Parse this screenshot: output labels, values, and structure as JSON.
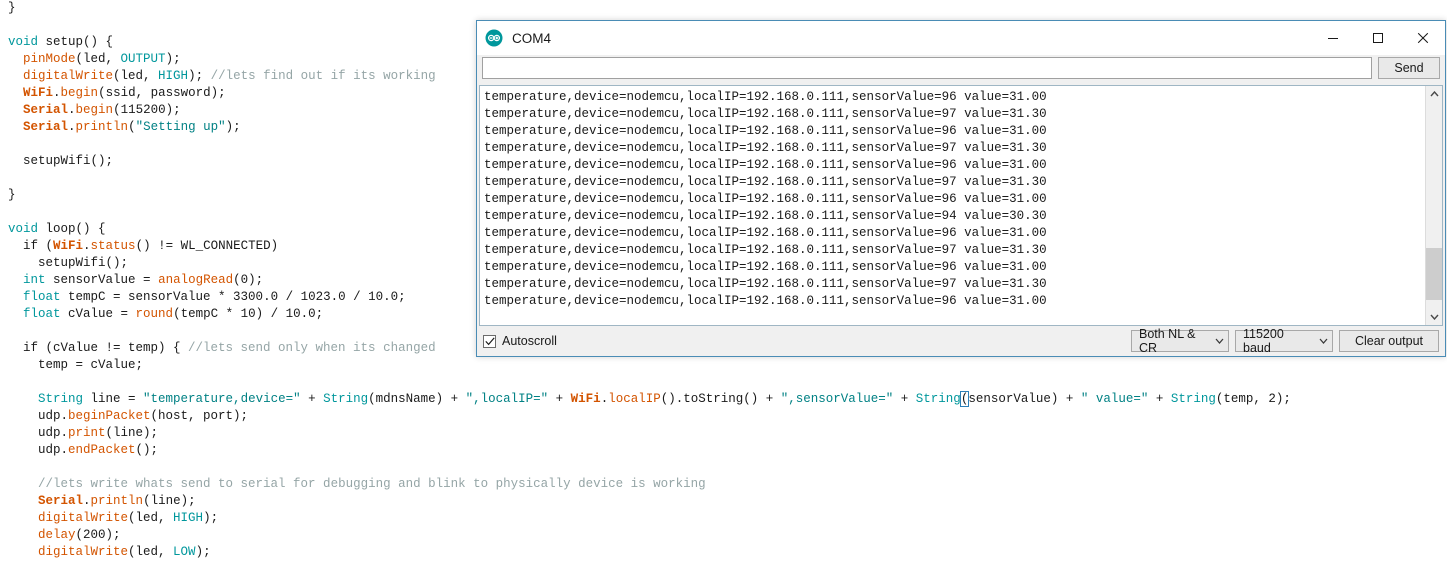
{
  "editor": {
    "lines": [
      [
        {
          "t": "}",
          "c": "pln"
        }
      ],
      [],
      [
        {
          "t": "void ",
          "c": "kw"
        },
        {
          "t": "setup",
          "c": "pln"
        },
        {
          "t": "() {",
          "c": "pln"
        }
      ],
      [
        {
          "t": "  ",
          "c": "pln"
        },
        {
          "t": "pinMode",
          "c": "fn"
        },
        {
          "t": "(led, ",
          "c": "pln"
        },
        {
          "t": "OUTPUT",
          "c": "cst"
        },
        {
          "t": ");",
          "c": "pln"
        }
      ],
      [
        {
          "t": "  ",
          "c": "pln"
        },
        {
          "t": "digitalWrite",
          "c": "fn"
        },
        {
          "t": "(led, ",
          "c": "pln"
        },
        {
          "t": "HIGH",
          "c": "cst"
        },
        {
          "t": "); ",
          "c": "pln"
        },
        {
          "t": "//lets find out if its working",
          "c": "cmt"
        }
      ],
      [
        {
          "t": "  ",
          "c": "pln"
        },
        {
          "t": "WiFi",
          "c": "fnb"
        },
        {
          "t": ".",
          "c": "pln"
        },
        {
          "t": "begin",
          "c": "fn"
        },
        {
          "t": "(ssid, password);",
          "c": "pln"
        }
      ],
      [
        {
          "t": "  ",
          "c": "pln"
        },
        {
          "t": "Serial",
          "c": "fnb"
        },
        {
          "t": ".",
          "c": "pln"
        },
        {
          "t": "begin",
          "c": "fn"
        },
        {
          "t": "(115200);",
          "c": "pln"
        }
      ],
      [
        {
          "t": "  ",
          "c": "pln"
        },
        {
          "t": "Serial",
          "c": "fnb"
        },
        {
          "t": ".",
          "c": "pln"
        },
        {
          "t": "println",
          "c": "fn"
        },
        {
          "t": "(",
          "c": "pln"
        },
        {
          "t": "\"Setting up\"",
          "c": "str"
        },
        {
          "t": ");",
          "c": "pln"
        }
      ],
      [],
      [
        {
          "t": "  setupWifi();",
          "c": "pln"
        }
      ],
      [],
      [
        {
          "t": "}",
          "c": "pln"
        }
      ],
      [],
      [
        {
          "t": "void ",
          "c": "kw"
        },
        {
          "t": "loop",
          "c": "pln"
        },
        {
          "t": "() {",
          "c": "pln"
        }
      ],
      [
        {
          "t": "  if (",
          "c": "pln"
        },
        {
          "t": "WiFi",
          "c": "fnb"
        },
        {
          "t": ".",
          "c": "pln"
        },
        {
          "t": "status",
          "c": "fn"
        },
        {
          "t": "() != WL_CONNECTED)",
          "c": "pln"
        }
      ],
      [
        {
          "t": "    setupWifi();",
          "c": "pln"
        }
      ],
      [
        {
          "t": "  ",
          "c": "pln"
        },
        {
          "t": "int ",
          "c": "kw"
        },
        {
          "t": "sensorValue = ",
          "c": "pln"
        },
        {
          "t": "analogRead",
          "c": "fn"
        },
        {
          "t": "(0);",
          "c": "pln"
        }
      ],
      [
        {
          "t": "  ",
          "c": "pln"
        },
        {
          "t": "float ",
          "c": "kw"
        },
        {
          "t": "tempC = sensorValue * 3300.0 / 1023.0 / 10.0;",
          "c": "pln"
        }
      ],
      [
        {
          "t": "  ",
          "c": "pln"
        },
        {
          "t": "float ",
          "c": "kw"
        },
        {
          "t": "cValue = ",
          "c": "pln"
        },
        {
          "t": "round",
          "c": "fn"
        },
        {
          "t": "(tempC * 10) / 10.0;",
          "c": "pln"
        }
      ],
      [],
      [
        {
          "t": "  if (cValue != temp) { ",
          "c": "pln"
        },
        {
          "t": "//lets send only when its changed",
          "c": "cmt"
        }
      ],
      [
        {
          "t": "    temp = cValue;",
          "c": "pln"
        }
      ],
      [],
      [
        {
          "t": "    ",
          "c": "pln"
        },
        {
          "t": "String ",
          "c": "cst"
        },
        {
          "t": "line = ",
          "c": "pln"
        },
        {
          "t": "\"temperature,device=\"",
          "c": "str"
        },
        {
          "t": " + ",
          "c": "pln"
        },
        {
          "t": "String",
          "c": "cst"
        },
        {
          "t": "(mdnsName) + ",
          "c": "pln"
        },
        {
          "t": "\",localIP=\"",
          "c": "str"
        },
        {
          "t": " + ",
          "c": "pln"
        },
        {
          "t": "WiFi",
          "c": "fnb"
        },
        {
          "t": ".",
          "c": "pln"
        },
        {
          "t": "localIP",
          "c": "fn"
        },
        {
          "t": "().toString() + ",
          "c": "pln"
        },
        {
          "t": "\",sensorValue=\"",
          "c": "str"
        },
        {
          "t": " + ",
          "c": "pln"
        },
        {
          "t": "String",
          "c": "cst"
        },
        {
          "t": "(",
          "c": "brkt"
        },
        {
          "t": "sensorValue) + ",
          "c": "pln"
        },
        {
          "t": "\" value=\"",
          "c": "str"
        },
        {
          "t": " + ",
          "c": "pln"
        },
        {
          "t": "String",
          "c": "cst"
        },
        {
          "t": "(temp, 2);",
          "c": "pln"
        }
      ],
      [
        {
          "t": "    udp.",
          "c": "pln"
        },
        {
          "t": "beginPacket",
          "c": "fn"
        },
        {
          "t": "(host, port);",
          "c": "pln"
        }
      ],
      [
        {
          "t": "    udp.",
          "c": "pln"
        },
        {
          "t": "print",
          "c": "fn"
        },
        {
          "t": "(line);",
          "c": "pln"
        }
      ],
      [
        {
          "t": "    udp.",
          "c": "pln"
        },
        {
          "t": "endPacket",
          "c": "fn"
        },
        {
          "t": "();",
          "c": "pln"
        }
      ],
      [],
      [
        {
          "t": "    ",
          "c": "pln"
        },
        {
          "t": "//lets write whats send to serial for debugging and blink to physically device is working",
          "c": "cmt"
        }
      ],
      [
        {
          "t": "    ",
          "c": "pln"
        },
        {
          "t": "Serial",
          "c": "fnb"
        },
        {
          "t": ".",
          "c": "pln"
        },
        {
          "t": "println",
          "c": "fn"
        },
        {
          "t": "(line);",
          "c": "pln"
        }
      ],
      [
        {
          "t": "    ",
          "c": "pln"
        },
        {
          "t": "digitalWrite",
          "c": "fn"
        },
        {
          "t": "(led, ",
          "c": "pln"
        },
        {
          "t": "HIGH",
          "c": "cst"
        },
        {
          "t": ");",
          "c": "pln"
        }
      ],
      [
        {
          "t": "    ",
          "c": "pln"
        },
        {
          "t": "delay",
          "c": "fn"
        },
        {
          "t": "(200);",
          "c": "pln"
        }
      ],
      [
        {
          "t": "    ",
          "c": "pln"
        },
        {
          "t": "digitalWrite",
          "c": "fn"
        },
        {
          "t": "(led, ",
          "c": "pln"
        },
        {
          "t": "LOW",
          "c": "cst"
        },
        {
          "t": ");",
          "c": "pln"
        }
      ]
    ]
  },
  "serial_monitor": {
    "title": "COM4",
    "icon": "arduino-logo-icon",
    "window_controls": {
      "minimize": "minimize-icon",
      "maximize": "maximize-icon",
      "close": "close-icon"
    },
    "send_input": {
      "value": "",
      "placeholder": ""
    },
    "send_button": "Send",
    "output_lines": [
      "temperature,device=nodemcu,localIP=192.168.0.111,sensorValue=96 value=31.00",
      "temperature,device=nodemcu,localIP=192.168.0.111,sensorValue=97 value=31.30",
      "temperature,device=nodemcu,localIP=192.168.0.111,sensorValue=96 value=31.00",
      "temperature,device=nodemcu,localIP=192.168.0.111,sensorValue=97 value=31.30",
      "temperature,device=nodemcu,localIP=192.168.0.111,sensorValue=96 value=31.00",
      "temperature,device=nodemcu,localIP=192.168.0.111,sensorValue=97 value=31.30",
      "temperature,device=nodemcu,localIP=192.168.0.111,sensorValue=96 value=31.00",
      "temperature,device=nodemcu,localIP=192.168.0.111,sensorValue=94 value=30.30",
      "temperature,device=nodemcu,localIP=192.168.0.111,sensorValue=96 value=31.00",
      "temperature,device=nodemcu,localIP=192.168.0.111,sensorValue=97 value=31.30",
      "temperature,device=nodemcu,localIP=192.168.0.111,sensorValue=96 value=31.00",
      "temperature,device=nodemcu,localIP=192.168.0.111,sensorValue=97 value=31.30",
      "temperature,device=nodemcu,localIP=192.168.0.111,sensorValue=96 value=31.00"
    ],
    "autoscroll": {
      "label": "Autoscroll",
      "checked": true
    },
    "line_ending": "Both NL & CR",
    "baud_rate": "115200 baud",
    "clear_button": "Clear output"
  },
  "colors": {
    "keyword": "#00979c",
    "function": "#d35400",
    "string": "#008184",
    "comment": "#95a5a6",
    "window_border": "#4a8cb5",
    "chrome_bg": "#f0f0f0"
  }
}
